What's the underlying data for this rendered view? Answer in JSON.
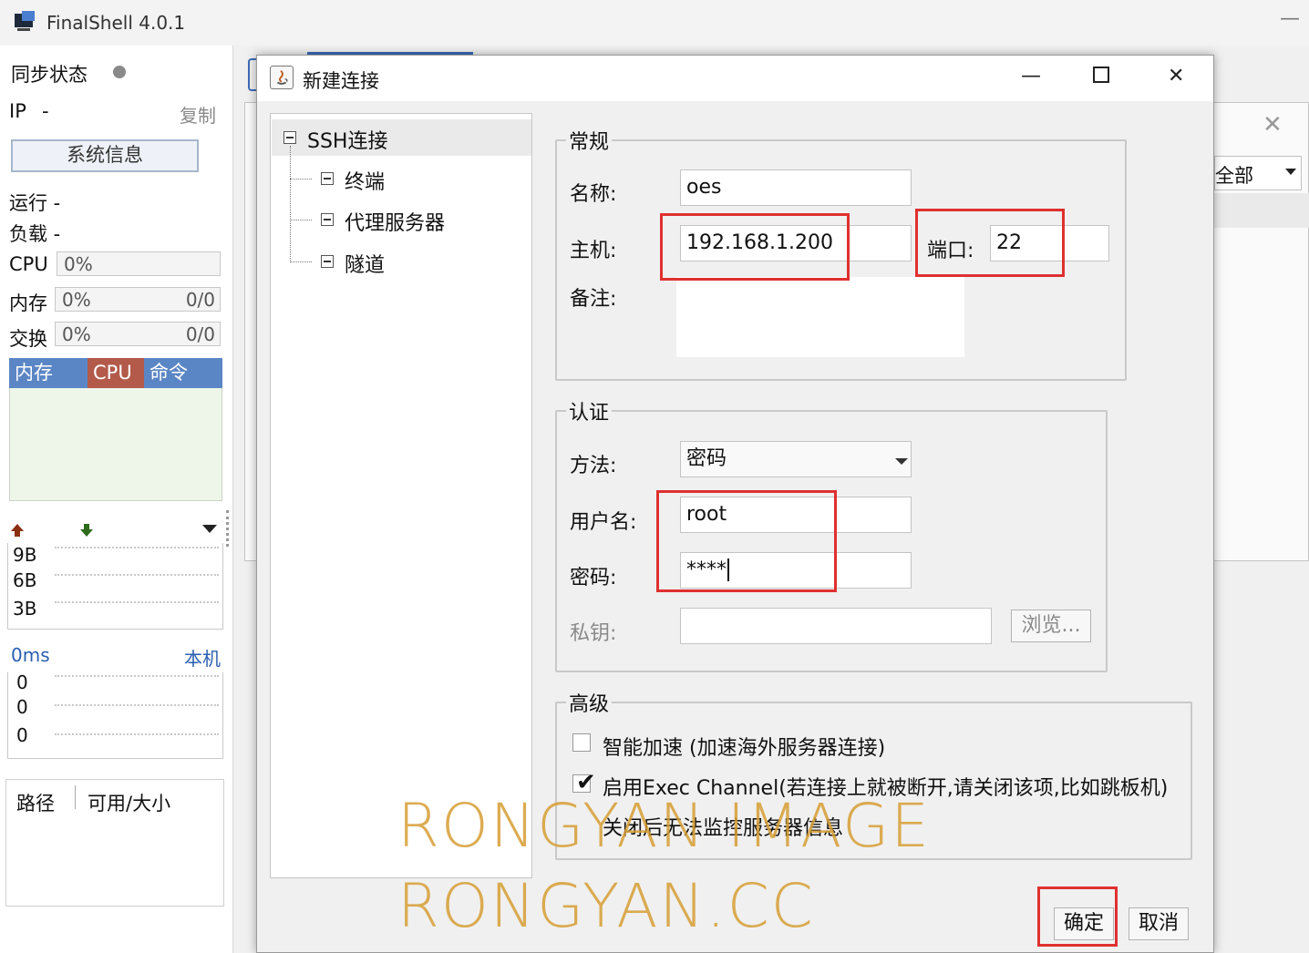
{
  "app": {
    "title": "FinalShell 4.0.1",
    "minimize_glyph": "—"
  },
  "left_panel": {
    "sync_label": "同步状态",
    "ip_label": "IP",
    "ip_value": "-",
    "copy_label": "复制",
    "sysinfo_button": "系统信息",
    "uptime_label": "运行 -",
    "load_label": "负载 -",
    "cpu": {
      "label": "CPU",
      "value": "0%"
    },
    "memory": {
      "label": "内存",
      "percent": "0%",
      "usage": "0/0"
    },
    "swap": {
      "label": "交换",
      "percent": "0%",
      "usage": "0/0"
    },
    "process_tabs": [
      "内存",
      "CPU",
      "命令"
    ],
    "net_scale": [
      "9B",
      "6B",
      "3B"
    ],
    "ping_label": "0ms",
    "ping_target": "本机",
    "ping_values": [
      "0",
      "0",
      "0"
    ],
    "disk_columns": [
      "路径",
      "可用/大小"
    ]
  },
  "background_window": {
    "filter_value": "全部"
  },
  "dialog": {
    "title": "新建连接",
    "controls": {
      "minimize": "—",
      "maximize": "☐",
      "close": "✕"
    },
    "tree": {
      "root": "SSH连接",
      "children": [
        "终端",
        "代理服务器",
        "隧道"
      ]
    },
    "general": {
      "title": "常规",
      "name_label": "名称:",
      "name_value": "oes",
      "host_label": "主机:",
      "host_value": "192.168.1.200",
      "port_label": "端口:",
      "port_value": "22",
      "note_label": "备注:"
    },
    "auth": {
      "title": "认证",
      "method_label": "方法:",
      "method_value": "密码",
      "username_label": "用户名:",
      "username_value": "root",
      "password_label": "密码:",
      "password_value": "****",
      "private_key_label": "私钥:",
      "browse_button": "浏览..."
    },
    "advanced": {
      "title": "高级",
      "smart_accel": {
        "label": "智能加速 (加速海外服务器连接)",
        "checked": false
      },
      "exec_channel": {
        "label": "启用Exec Channel(若连接上就被断开,请关闭该项,比如跳板机)",
        "label_line2": "关闭后无法监控服务器信息",
        "checked": true
      }
    },
    "ok_button": "确定",
    "cancel_button": "取消"
  },
  "watermark": [
    "RONGYAN IMAGE",
    "RONGYAN.CC"
  ],
  "colors": {
    "highlight_red": "#e03030",
    "tab_blue": "#5b86c5",
    "tab_cpu": "#b35a4a",
    "watermark": "#d69e34"
  }
}
